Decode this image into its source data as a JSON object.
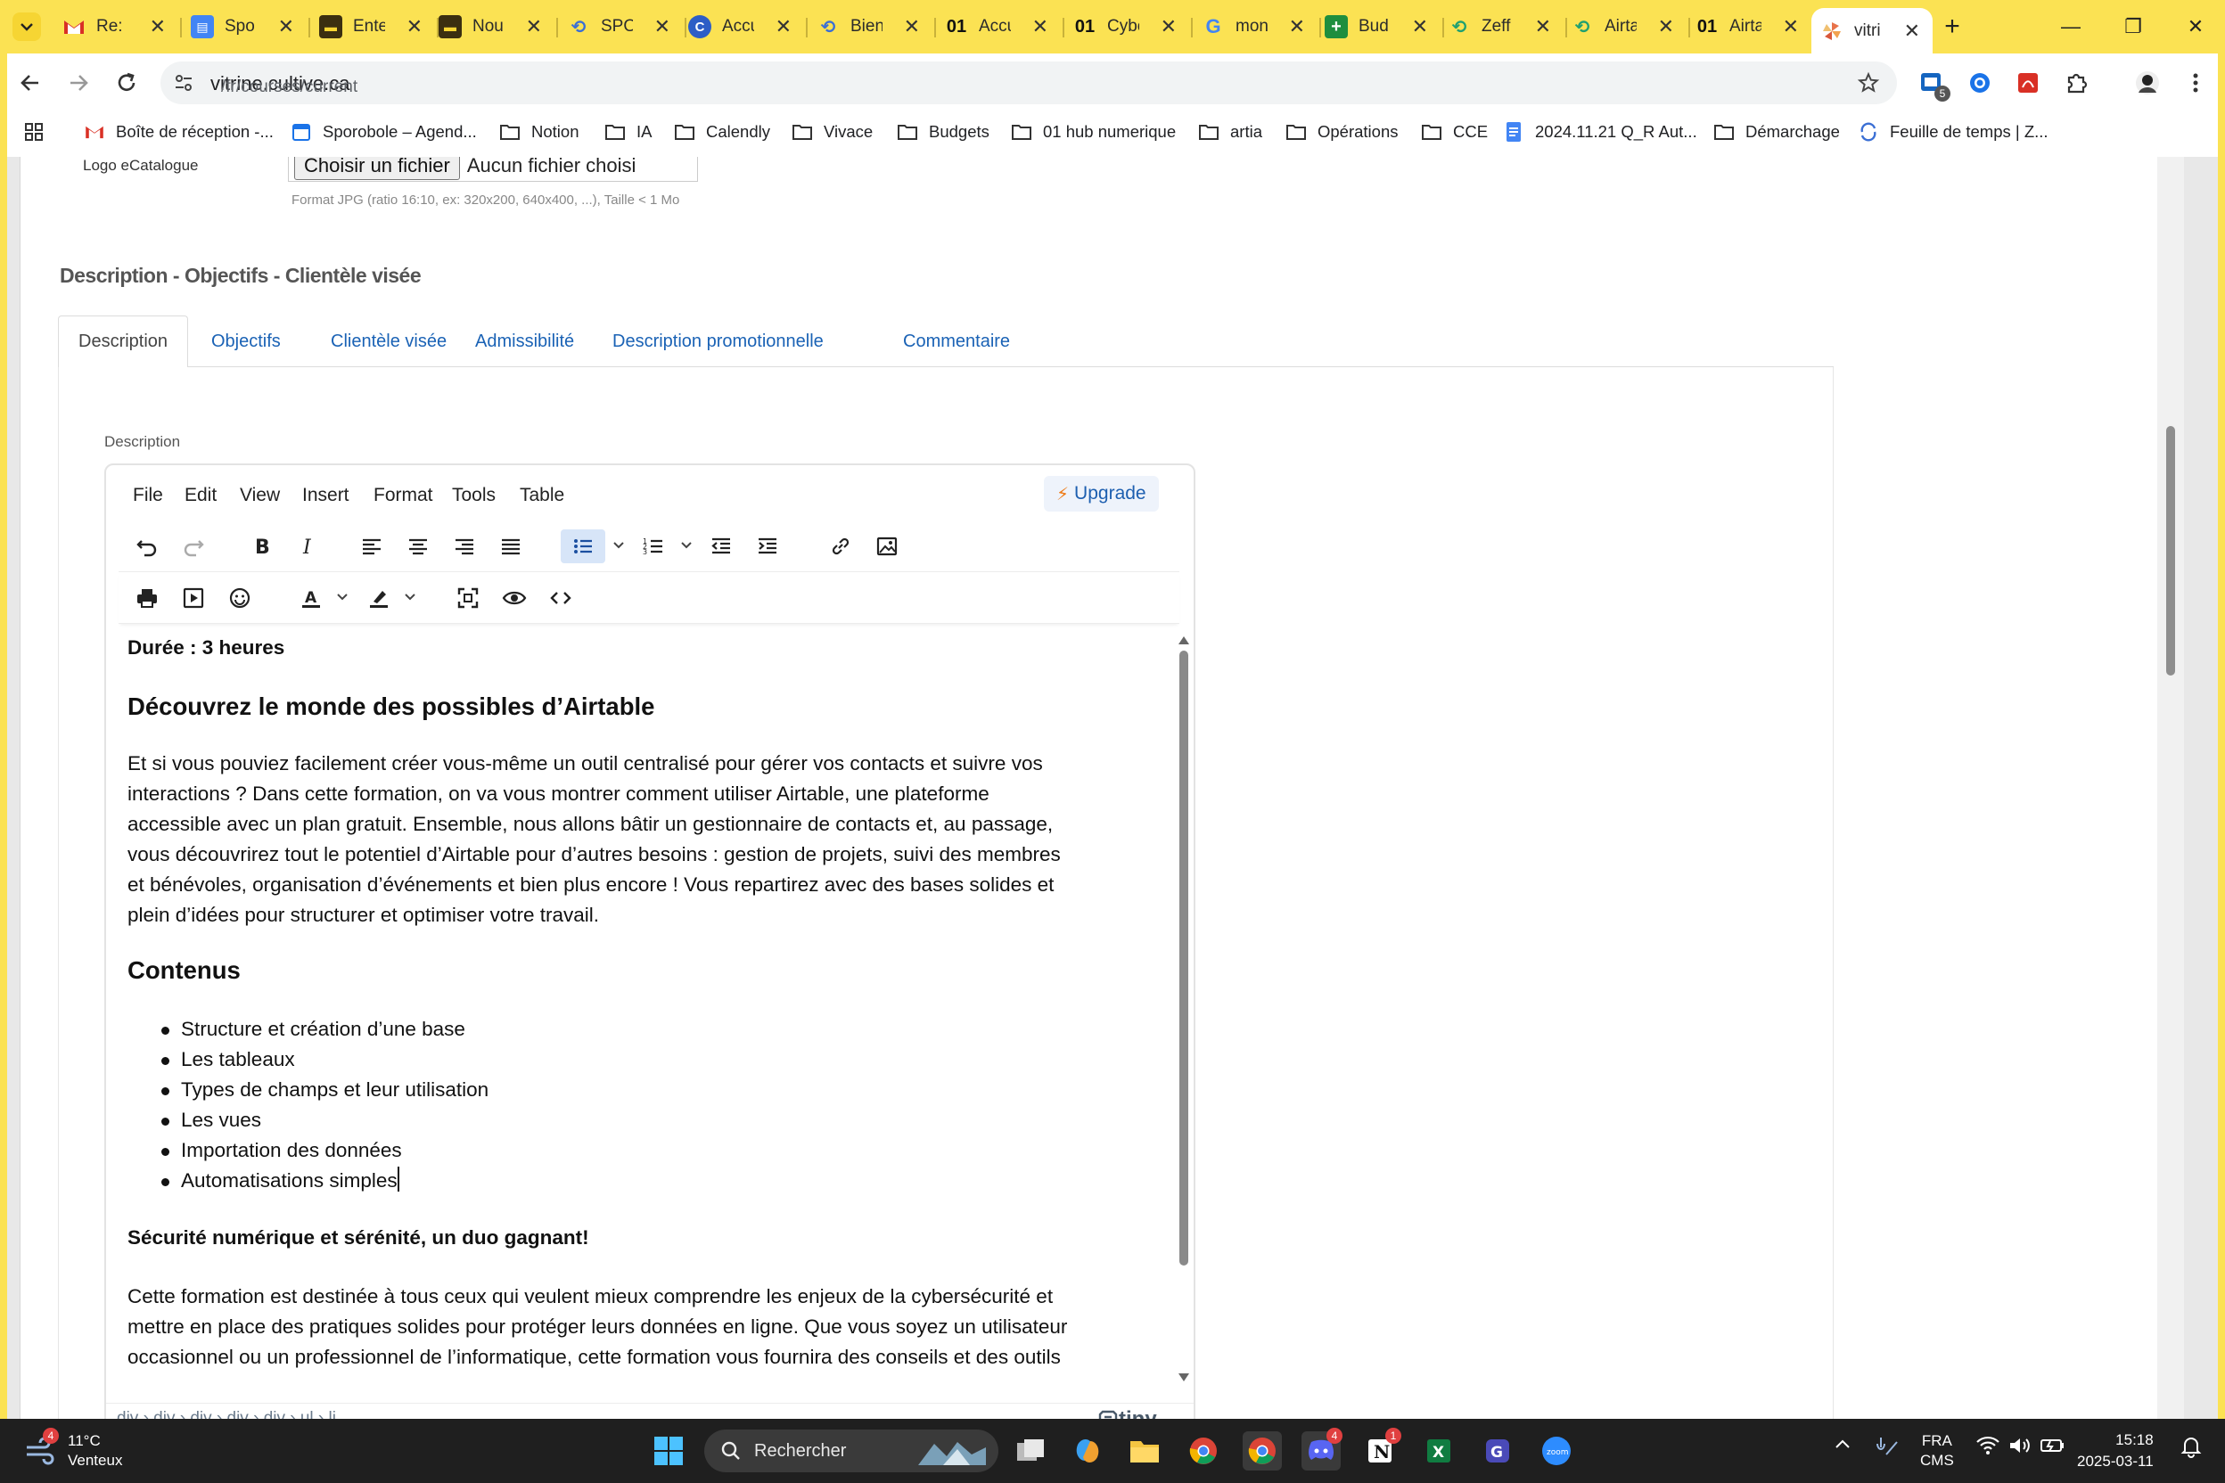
{
  "browser": {
    "tabs": [
      {
        "icon": "gmail-icon",
        "title": "Re: r"
      },
      {
        "icon": "docs-icon",
        "title": "Spo"
      },
      {
        "icon": "slides-icon",
        "title": "Ente"
      },
      {
        "icon": "slides-icon",
        "title": "Nou"
      },
      {
        "icon": "link-icon",
        "title": "SPO"
      },
      {
        "icon": "chrome-circle-icon",
        "title": "Accu"
      },
      {
        "icon": "link-icon",
        "title": "Bien"
      },
      {
        "icon": "o1-icon",
        "title": "Accu"
      },
      {
        "icon": "o1-icon",
        "title": "Cybe"
      },
      {
        "icon": "google-icon",
        "title": "mon"
      },
      {
        "icon": "sheets-icon",
        "title": "Bud"
      },
      {
        "icon": "link-icon",
        "title": "Zeff"
      },
      {
        "icon": "link-icon",
        "title": "Airta"
      },
      {
        "icon": "o1-icon",
        "title": "Airta"
      },
      {
        "icon": "pinwheel-icon",
        "title": "vitri"
      }
    ],
    "url_host": "vitrine.cultive.ca",
    "url_path": "/fr/courses/current",
    "extension_badge": "5",
    "bookmarks": [
      "Boîte de réception -...",
      "Sporobole – Agend...",
      "Notion",
      "IA",
      "Calendly",
      "Vivace",
      "Budgets",
      "01 hub numerique",
      "artia",
      "Opérations",
      "CCE",
      "2024.11.21 Q_R Aut...",
      "Démarchage",
      "Feuille de temps | Z..."
    ]
  },
  "form": {
    "logo_label": "Logo eCatalogue",
    "file_button": "Choisir un fichier",
    "file_status": "Aucun fichier choisi",
    "file_hint": "Format JPG (ratio 16:10, ex: 320x200, 640x400, ...), Taille < 1 Mo",
    "section_title": "Description - Objectifs - Clientèle visée",
    "tabs": [
      "Description",
      "Objectifs",
      "Clientèle visée",
      "Admissibilité",
      "Description promotionnelle",
      "Commentaire"
    ],
    "description_label": "Description"
  },
  "editor": {
    "menu": [
      "File",
      "Edit",
      "View",
      "Insert",
      "Format",
      "Tools",
      "Table"
    ],
    "upgrade_label": "Upgrade",
    "duration": "Durée : 3 heures",
    "heading1": "Découvrez le monde des possibles d’Airtable",
    "paragraph1": [
      "Et si vous pouviez facilement créer vous-même un outil centralisé pour gérer vos contacts et suivre vos",
      "interactions ? Dans cette formation, on va vous montrer comment utiliser Airtable, une plateforme",
      "accessible avec un plan gratuit. Ensemble, nous allons bâtir un gestionnaire de contacts et, au passage,",
      "vous découvrirez tout le potentiel d’Airtable pour d’autres besoins : gestion de projets, suivi des membres",
      "et bénévoles, organisation d’événements et bien plus encore ! Vous repartirez avec des bases solides et",
      "plein d’idées pour structurer et optimiser votre travail."
    ],
    "heading2": "Contenus",
    "list": [
      "Structure et création d’une base",
      "Les tableaux",
      "Types de champs et leur utilisation",
      "Les vues",
      "Importation des données",
      "Automatisations simples"
    ],
    "heading3": "Sécurité numérique et sérénité, un duo gagnant!",
    "paragraph2": [
      "Cette formation est destinée à tous ceux qui veulent mieux comprendre les enjeux de la cybersécurité et",
      "mettre en place des pratiques solides pour protéger leurs données en ligne. Que vous soyez un utilisateur",
      "occasionnel ou un professionnel de l’informatique, cette formation vous fournira des conseils et des outils"
    ],
    "element_path": "div › div › div › div › div › ul › li",
    "brand": "tiny"
  },
  "taskbar": {
    "weather_temp": "11°C",
    "weather_desc": "Venteux",
    "weather_badge": "4",
    "search_label": "Rechercher",
    "discord_badge": "4",
    "notion_badge": "1",
    "lang_top": "FRA",
    "lang_bottom": "CMS",
    "time": "15:18",
    "date": "2025-03-11"
  },
  "colors": {
    "chrome_theme": "#fbe253",
    "link_blue": "#1a62b5",
    "active_button": "#d7e5f8"
  }
}
